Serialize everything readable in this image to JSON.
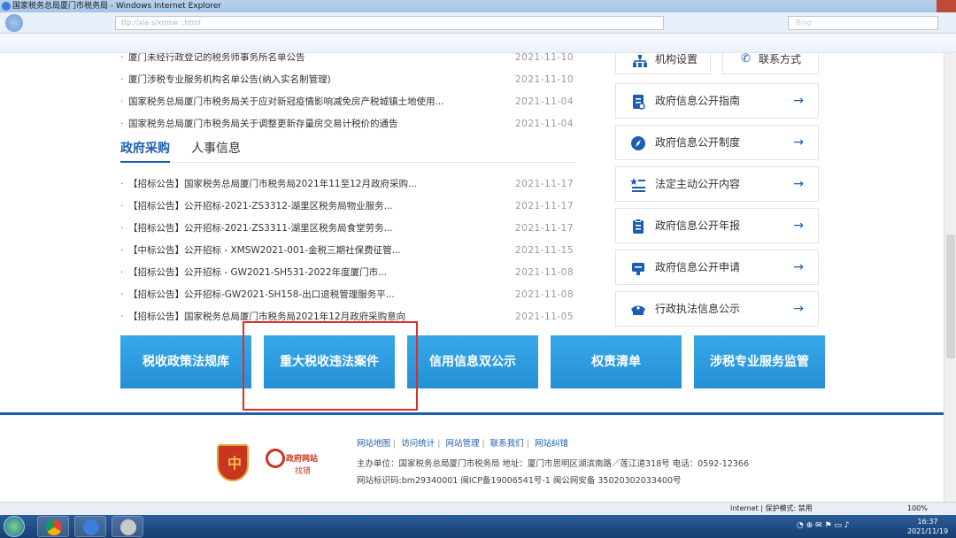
{
  "window": {
    "title": "国家税务总局厦门市税务局 - Windows Internet Explorer",
    "url": "ttp://xia            s/xmsw        ..html",
    "search_placeholder": "Bing"
  },
  "news_top": [
    {
      "text": "厦门未经行政登记的税务师事务所名单公告",
      "date": "2021-11-10"
    },
    {
      "text": "厦门涉税专业服务机构名单公告(纳入实名制管理)",
      "date": "2021-11-10"
    },
    {
      "text": "国家税务总局厦门市税务局关于应对新冠疫情影响减免房产税城镇土地使用...",
      "date": "2021-11-04"
    },
    {
      "text": "国家税务总局厦门市税务局关于调整更新存量房交易计税价的通告",
      "date": "2021-11-04"
    }
  ],
  "tabs": [
    {
      "label": "政府采购"
    },
    {
      "label": "人事信息"
    }
  ],
  "procurement": [
    {
      "text": "【招标公告】国家税务总局厦门市税务局2021年11至12月政府采购...",
      "date": "2021-11-17"
    },
    {
      "text": "【招标公告】公开招标-2021-ZS3312-湖里区税务局物业服务...",
      "date": "2021-11-17"
    },
    {
      "text": "【招标公告】公开招标-2021-ZS3311-湖里区税务局食堂劳务...",
      "date": "2021-11-17"
    },
    {
      "text": "【中标公告】公开招标 - XMSW2021-001-金税三期社保费征管...",
      "date": "2021-11-15"
    },
    {
      "text": "【招标公告】公开招标 - GW2021-SH531-2022年度厦门市...",
      "date": "2021-11-08"
    },
    {
      "text": "【招标公告】公开招标-GW2021-SH158-出口退税管理服务平...",
      "date": "2021-11-08"
    },
    {
      "text": "【招标公告】国家税务总局厦门市税务局2021年12月政府采购意向",
      "date": "2021-11-05"
    }
  ],
  "sidebar_top": [
    {
      "label": "机构设置"
    },
    {
      "label": "联系方式"
    }
  ],
  "sidebar": [
    {
      "label": "政府信息公开指南",
      "icon": "document-icon"
    },
    {
      "label": "政府信息公开制度",
      "icon": "compass-icon"
    },
    {
      "label": "法定主动公开内容",
      "icon": "star-list-icon"
    },
    {
      "label": "政府信息公开年报",
      "icon": "clipboard-icon"
    },
    {
      "label": "政府信息公开申请",
      "icon": "form-icon"
    },
    {
      "label": "行政执法信息公示",
      "icon": "police-cap-icon"
    }
  ],
  "arrow": "→",
  "banners": [
    {
      "label": "税收政策法规库"
    },
    {
      "label": "重大税收违法案件"
    },
    {
      "label": "信用信息双公示"
    },
    {
      "label": "权责清单"
    },
    {
      "label": "涉税专业服务监管"
    }
  ],
  "footer": {
    "links": [
      "网站地图",
      "访问统计",
      "网站管理",
      "联系我们",
      "网站纠错"
    ],
    "host": "主办单位：国家税务总局厦门市税务局    地址：厦门市思明区湖滨南路／莲江道318号    电话：0592-12366",
    "ids": "网站标识码:bm29340001    闽ICP备19006541号-1    闽公网安备 35020302033400号",
    "badge_label": "政府网站",
    "badge_sub": "找错"
  },
  "statusbar": {
    "zone": "Internet | 保护模式: 禁用",
    "zoom": "100%"
  },
  "taskbar": {
    "time": "16:37",
    "date": "2021/11/19"
  }
}
